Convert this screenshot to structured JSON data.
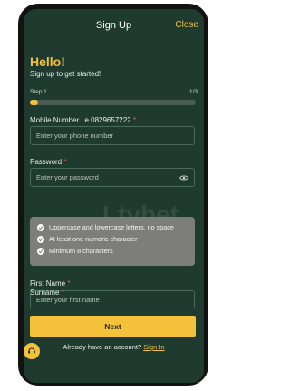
{
  "header": {
    "title": "Sign Up",
    "close_label": "Close"
  },
  "intro": {
    "hello": "Hello!",
    "subtitle": "Sign up to get started!"
  },
  "progress": {
    "step_label": "Step 1",
    "step_count": "1/3",
    "fraction": 0.05
  },
  "mobile": {
    "label": "Mobile Number i.e 0829657222",
    "placeholder": "Enter your phone number"
  },
  "password": {
    "label": "Password",
    "placeholder": "Enter your password"
  },
  "password_rules": [
    "Uppercase and lowercase letters, no space",
    "At least one numeric character",
    "Minimum 8 characters"
  ],
  "first_name": {
    "label": "First Name",
    "placeholder": "Enter your first name"
  },
  "surname": {
    "label": "Surname"
  },
  "footer": {
    "next_label": "Next",
    "already_text": "Already have an account?",
    "signin_label": "Sign In"
  },
  "watermark_text": "Ltybet",
  "colors": {
    "accent": "#f3c13a",
    "background": "#1f3a2f",
    "required": "#e65a5a"
  },
  "icons": {
    "eye": "eye-icon",
    "check": "check-circle-icon",
    "chat": "chat-support-icon"
  }
}
